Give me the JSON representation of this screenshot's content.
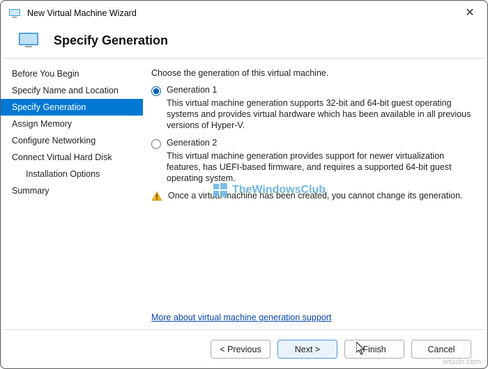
{
  "titlebar": {
    "title": "New Virtual Machine Wizard"
  },
  "header": {
    "title": "Specify Generation"
  },
  "sidebar": {
    "items": [
      {
        "label": "Before You Begin"
      },
      {
        "label": "Specify Name and Location"
      },
      {
        "label": "Specify Generation"
      },
      {
        "label": "Assign Memory"
      },
      {
        "label": "Configure Networking"
      },
      {
        "label": "Connect Virtual Hard Disk"
      },
      {
        "label": "Installation Options"
      },
      {
        "label": "Summary"
      }
    ]
  },
  "content": {
    "intro": "Choose the generation of this virtual machine.",
    "gen1_label": "Generation 1",
    "gen1_desc": "This virtual machine generation supports 32-bit and 64-bit guest operating systems and provides virtual hardware which has been available in all previous versions of Hyper-V.",
    "gen2_label": "Generation 2",
    "gen2_desc": "This virtual machine generation provides support for newer virtualization features, has UEFI-based firmware, and requires a supported 64-bit guest operating system.",
    "warning": "Once a virtual machine has been created, you cannot change its generation.",
    "more_link": "More about virtual machine generation support"
  },
  "watermark": "TheWindowsClub",
  "buttons": {
    "previous": "< Previous",
    "next": "Next >",
    "finish": "Finish",
    "cancel": "Cancel"
  },
  "site_watermark": "wsxdn.com"
}
